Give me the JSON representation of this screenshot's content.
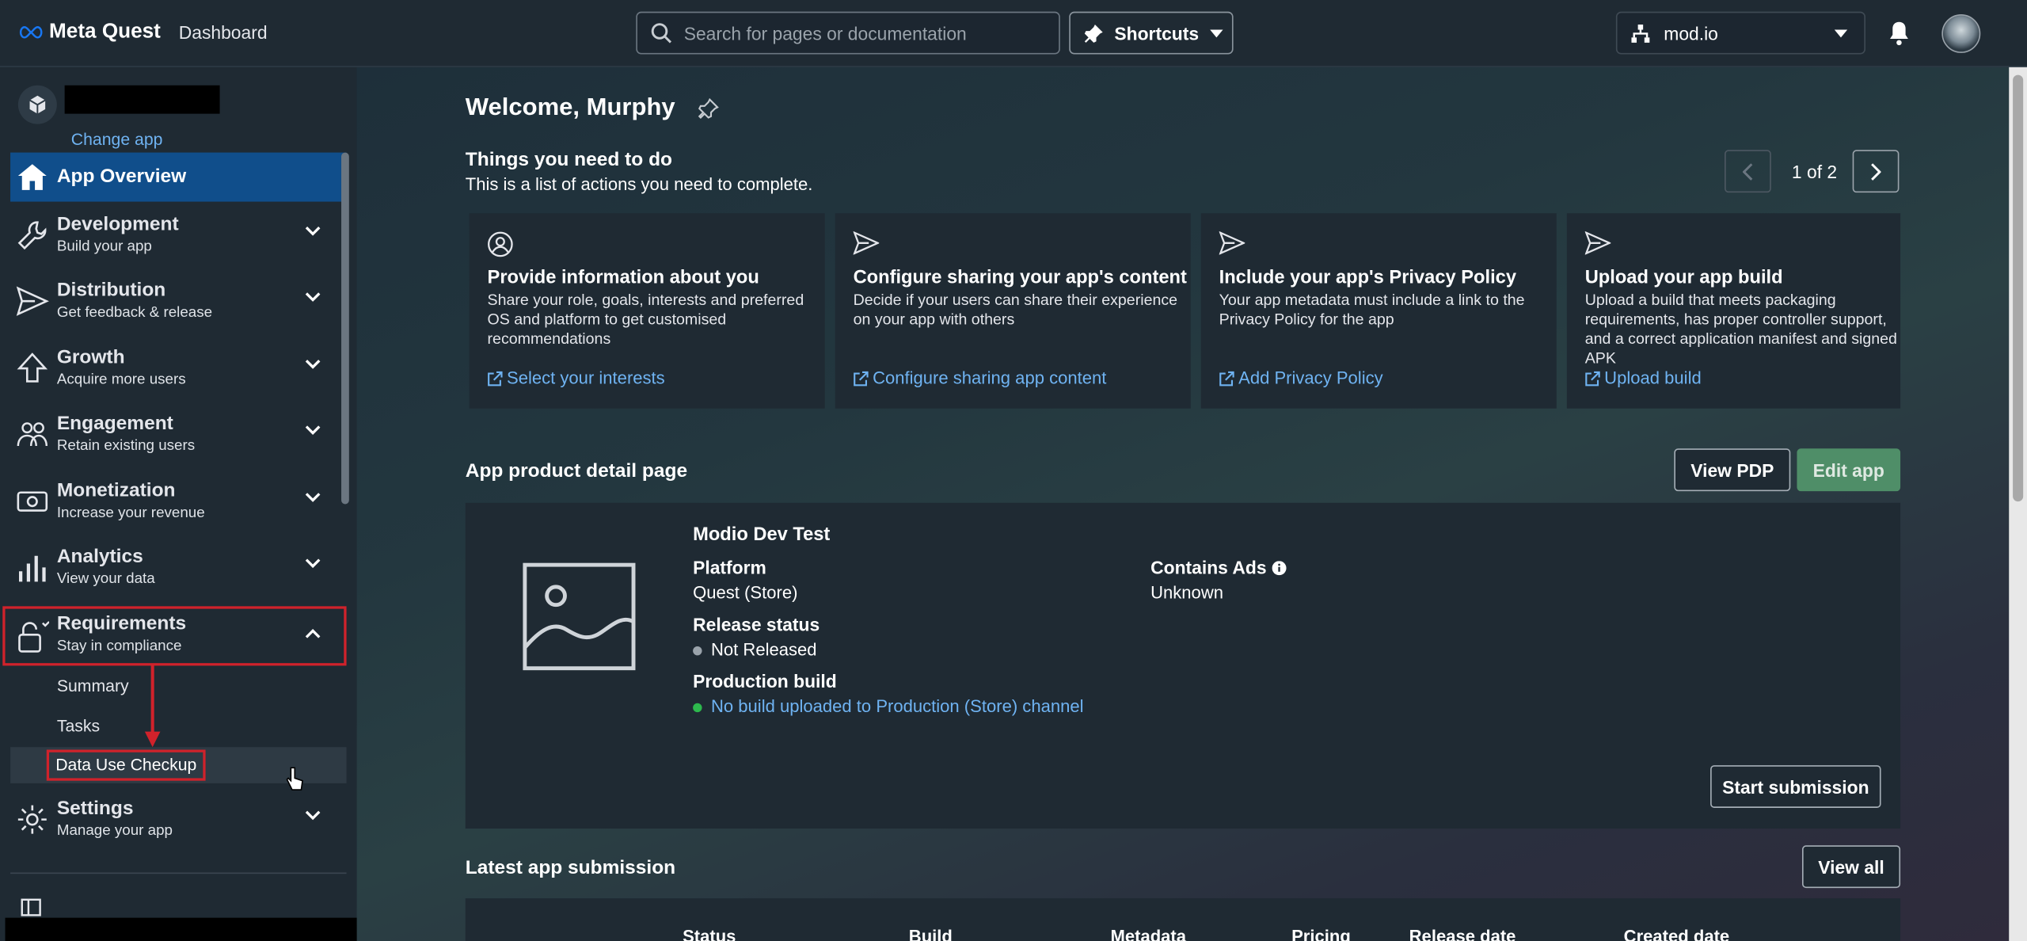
{
  "topbar": {
    "brand": "Meta Quest",
    "section": "Dashboard",
    "search_placeholder": "Search for pages or documentation",
    "shortcuts_label": "Shortcuts",
    "org_name": "mod.io"
  },
  "sidebar": {
    "change_app": "Change app",
    "overview": "App Overview",
    "items": [
      {
        "title": "Development",
        "subtitle": "Build your app"
      },
      {
        "title": "Distribution",
        "subtitle": "Get feedback & release"
      },
      {
        "title": "Growth",
        "subtitle": "Acquire more users"
      },
      {
        "title": "Engagement",
        "subtitle": "Retain existing users"
      },
      {
        "title": "Monetization",
        "subtitle": "Increase your revenue"
      },
      {
        "title": "Analytics",
        "subtitle": "View your data"
      },
      {
        "title": "Requirements",
        "subtitle": "Stay in compliance"
      },
      {
        "title": "Settings",
        "subtitle": "Manage your app"
      }
    ],
    "requirements_sub": [
      "Summary",
      "Tasks",
      "Data Use Checkup"
    ]
  },
  "main": {
    "welcome": "Welcome, Murphy",
    "todo_title": "Things you need to do",
    "todo_sub": "This is a list of actions you need to complete.",
    "pager": "1 of 2",
    "tasks": [
      {
        "title": "Provide information about you",
        "desc": "Share your role, goals, interests and preferred OS and platform to get customised recommendations",
        "link": "Select your interests"
      },
      {
        "title": "Configure sharing your app's content",
        "desc": "Decide if your users can share their experience on your app with others",
        "link": "Configure sharing app content"
      },
      {
        "title": "Include your app's Privacy Policy",
        "desc": "Your app metadata must include a link to the Privacy Policy for the app",
        "link": "Add Privacy Policy"
      },
      {
        "title": "Upload your app build",
        "desc": "Upload a build that meets packaging requirements, has proper controller support, and a correct application manifest and signed APK",
        "link": "Upload build"
      }
    ],
    "pdp_title": "App product detail page",
    "view_pdp": "View PDP",
    "edit_app": "Edit app",
    "app_name": "Modio Dev Test",
    "platform_label": "Platform",
    "platform_value": "Quest (Store)",
    "contains_ads_label": "Contains Ads",
    "contains_ads_value": "Unknown",
    "release_label": "Release status",
    "release_value": "Not Released",
    "prod_build_label": "Production build",
    "prod_build_value": "No build uploaded to Production (Store) channel",
    "start_submission": "Start submission",
    "latest_title": "Latest app submission",
    "view_all": "View all",
    "table_headers": [
      "Status",
      "Build",
      "Metadata",
      "Pricing",
      "Release date",
      "Created date"
    ]
  },
  "colors": {
    "accent": "#104e8b",
    "link": "#6fb3f2",
    "highlight": "#d0222b",
    "edit_button": "#4f8e68"
  }
}
